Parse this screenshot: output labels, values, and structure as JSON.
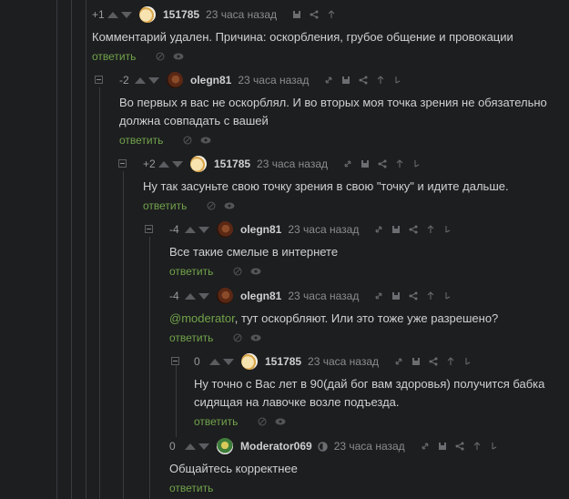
{
  "comments": [
    {
      "rating": "+1",
      "author": "151785",
      "time": "23 часа назад",
      "text": "Комментарий удален. Причина: оскорбления, грубое общение и провокации",
      "reply": "ответить"
    },
    {
      "rating": "-2",
      "author": "olegn81",
      "time": "23 часа назад",
      "text": "Во первых я вас не оскорблял. И во вторых моя точка зрения не обязательно должна совпадать с вашей",
      "reply": "ответить"
    },
    {
      "rating": "+2",
      "author": "151785",
      "time": "23 часа назад",
      "text": "Ну так засуньте свою точку зрения в свою \"точку\" и идите дальше.",
      "reply": "ответить"
    },
    {
      "rating": "-4",
      "author": "olegn81",
      "time": "23 часа назад",
      "text": "Все такие смелые в интернете",
      "reply": "ответить"
    },
    {
      "rating": "-4",
      "author": "olegn81",
      "time": "23 часа назад",
      "mention": "@moderator",
      "text": ", тут оскорбляют. Или это тоже уже разрешено?",
      "reply": "ответить"
    },
    {
      "rating": "0",
      "author": "151785",
      "time": "23 часа назад",
      "text": "Ну точно с Вас лет в 90(дай бог вам здоровья) получится бабка сидящая на лавочке возле подъезда.",
      "reply": "ответить"
    },
    {
      "rating": "0",
      "author": "Moderator069",
      "time": "23 часа назад",
      "text": "Общайтесь корректнее",
      "reply": "ответить"
    }
  ],
  "icons": [
    "link-icon",
    "save-icon",
    "share-icon",
    "jump-up-icon",
    "hide-icon",
    "eye-icon",
    "moderator-badge-icon"
  ]
}
